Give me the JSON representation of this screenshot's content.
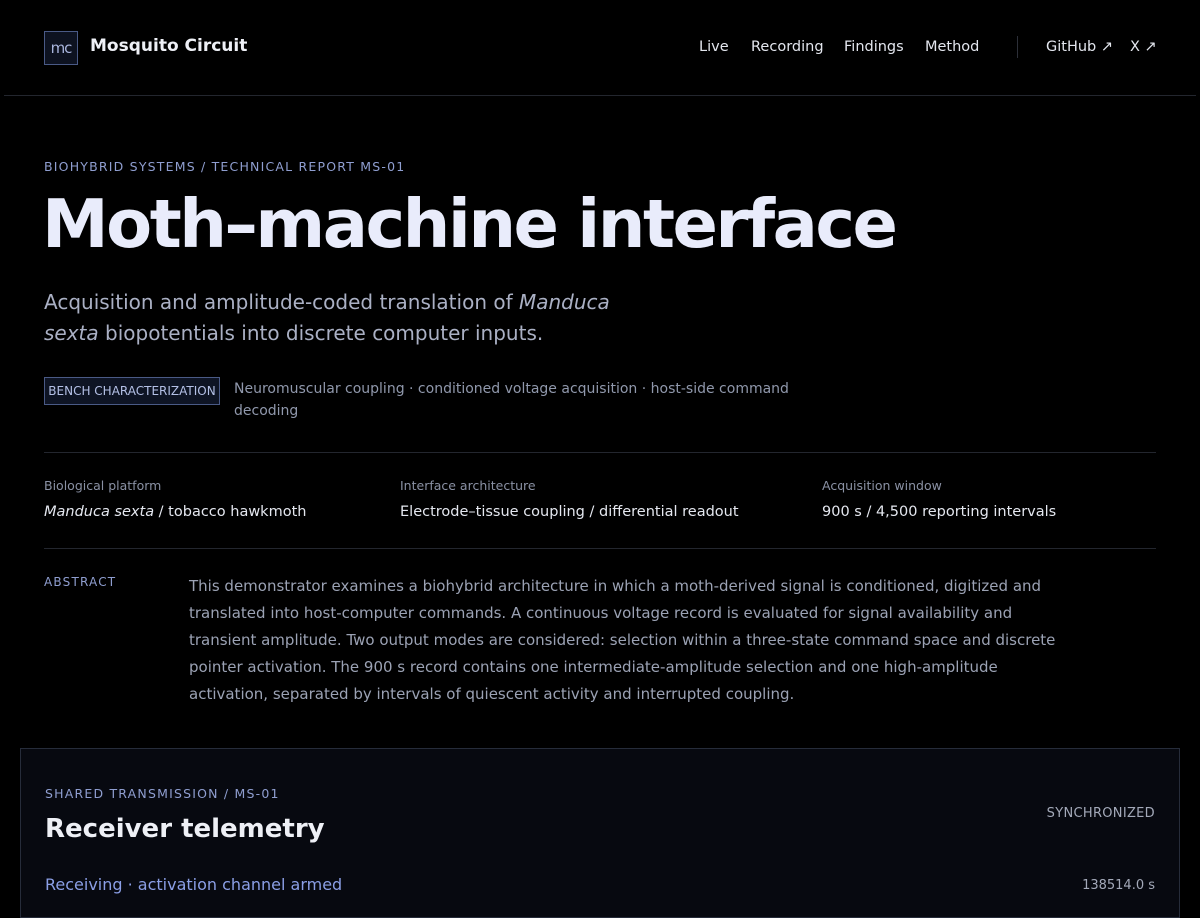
{
  "brand": {
    "logo": "mc",
    "name": "Mosquito Circuit"
  },
  "nav": {
    "items": [
      "Live",
      "Recording",
      "Findings",
      "Method"
    ],
    "external": [
      "GitHub ↗",
      "X ↗"
    ]
  },
  "hero": {
    "eyebrow": "BIOHYBRID SYSTEMS / TECHNICAL REPORT MS-01",
    "title": "Moth–machine interface",
    "subtitle_pre": "Acquisition and amplitude-coded translation of ",
    "subtitle_species": "Manduca sexta",
    "subtitle_post": " biopotentials into discrete computer inputs.",
    "badge": "BENCH CHARACTERIZATION",
    "badge_desc": "Neuromuscular coupling · conditioned voltage acquisition · host-side command decoding"
  },
  "meta": [
    {
      "label": "Biological platform",
      "value_em": "Manduca sexta",
      "value": " / tobacco hawkmoth"
    },
    {
      "label": "Interface architecture",
      "value_em": "",
      "value": "Electrode–tissue coupling / differential readout"
    },
    {
      "label": "Acquisition window",
      "value_em": "",
      "value": "900 s / 4,500 reporting intervals"
    }
  ],
  "abstract": {
    "label": "ABSTRACT",
    "text": "This demonstrator examines a biohybrid architecture in which a moth-derived signal is conditioned, digitized and translated into host-computer commands. A continuous voltage record is evaluated for signal availability and transient amplitude. Two output modes are considered: selection within a three-state command space and discrete pointer activation. The 900 s record contains one intermediate-amplitude selection and one high-amplitude activation, separated by intervals of quiescent activity and interrupted coupling."
  },
  "telemetry": {
    "eyebrow": "SHARED TRANSMISSION / MS-01",
    "title": "Receiver telemetry",
    "status": "SYNCHRONIZED",
    "receiving": "Receiving · activation channel armed",
    "time": "138514.0 s"
  },
  "colors": {
    "accent": "#8f9ed0",
    "background": "#000000",
    "link": "#8b9fe6"
  }
}
